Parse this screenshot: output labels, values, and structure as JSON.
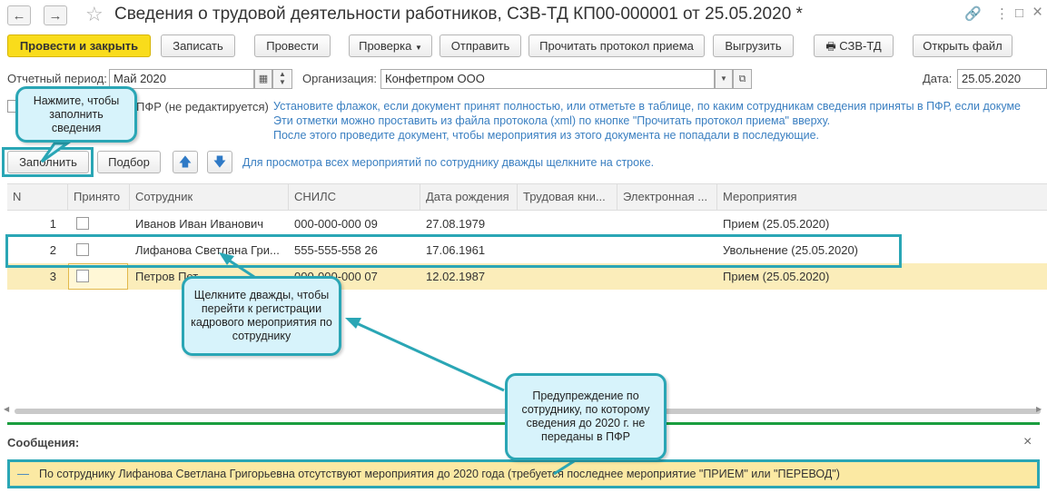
{
  "window": {
    "title": "Сведения о трудовой деятельности работников, СЗВ-ТД КП00-000001 от 25.05.2020 *",
    "back_icon": "←",
    "forward_icon": "→",
    "star_icon": "☆",
    "link_icon": "🔗",
    "menu_icon": "⋮",
    "max_icon": "□",
    "close_icon": "×"
  },
  "toolbar": {
    "post_close": "Провести и закрыть",
    "save": "Записать",
    "post": "Провести",
    "check": "Проверка",
    "send": "Отправить",
    "read_protocol": "Прочитать протокол приема",
    "export": "Выгрузить",
    "szv_td": "СЗВ-ТД",
    "open_file": "Открыть файл"
  },
  "header": {
    "period_label": "Отчетный период:",
    "period_value": "Май 2020",
    "org_label": "Организация:",
    "org_value": "Конфетпром ООО",
    "date_label": "Дата:",
    "date_value": "25.05.2020",
    "accepted_fragment": "ПФР (не редактируется)"
  },
  "notes": [
    "Установите флажок, если документ принят полностью, или отметьте в таблице, по каким сотрудникам сведения приняты в ПФР, если докуме",
    "Эти отметки можно проставить из файла протокола (xml) по кнопке \"Прочитать протокол приема\" вверху.",
    "После этого проведите документ, чтобы мероприятия из этого документа не попадали в последующие."
  ],
  "table_toolbar": {
    "fill": "Заполнить",
    "select": "Подбор",
    "hint": "Для просмотра всех мероприятий по сотруднику дважды щелкните на строке."
  },
  "table": {
    "columns": [
      "N",
      "Принято",
      "Сотрудник",
      "СНИЛС",
      "Дата рождения",
      "Трудовая кни...",
      "Электронная ...",
      "Мероприятия"
    ],
    "rows": [
      {
        "n": "1",
        "employee": "Иванов Иван Иванович",
        "snils": "000-000-000 09",
        "birth": "27.08.1979",
        "book": "",
        "electronic": "",
        "events": "Прием (25.05.2020)"
      },
      {
        "n": "2",
        "employee": "Лифанова Светлана Гри...",
        "snils": "555-555-558 26",
        "birth": "17.06.1961",
        "book": "",
        "electronic": "",
        "events": "Увольнение (25.05.2020)"
      },
      {
        "n": "3",
        "employee": "Петров Пет...",
        "snils": "000-000-000 07",
        "birth": "12.02.1987",
        "book": "",
        "electronic": "",
        "events": "Прием (25.05.2020)"
      }
    ]
  },
  "messages": {
    "title": "Сообщения:",
    "close_icon": "×",
    "text": "По сотруднику Лифанова Светлана Григорьевна отсутствуют мероприятия до 2020 года (требуется последнее мероприятие \"ПРИЕМ\" или \"ПЕРЕВОД\")"
  },
  "callouts": {
    "fill_hint": "Нажмите, чтобы заполнить сведения",
    "row_hint": "Щелкните дважды, чтобы перейти к регистрации кадрового мероприятия по сотруднику",
    "warning_hint": "Предупреждение по сотруднику, по которому сведения до 2020 г. не переданы в ПФР"
  },
  "colors": {
    "accent_yellow": "#f9dc1b",
    "callout_border": "#2aa6b5",
    "callout_fill": "#d7f3fb",
    "note_blue": "#3a7fc1",
    "message_bg": "#fbe9a3",
    "divider_green": "#1a9e3f"
  }
}
